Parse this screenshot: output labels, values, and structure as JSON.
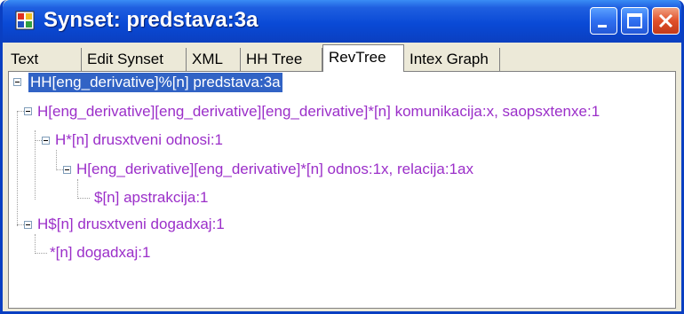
{
  "window": {
    "title": "Synset: predstava:3a",
    "icon": "app-window-icon",
    "controls": [
      "minimize-icon",
      "maximize-icon",
      "close-icon"
    ]
  },
  "tabs": [
    {
      "label": "Text"
    },
    {
      "label": "Edit Synset"
    },
    {
      "label": "XML"
    },
    {
      "label": "HH Tree"
    },
    {
      "label": "RevTree",
      "active": true
    },
    {
      "label": "Intex Graph"
    }
  ],
  "tree": {
    "nodes": [
      {
        "label": "HH[eng_derivative]%[n] predstava:3a",
        "selected": true
      },
      {
        "label": "H[eng_derivative][eng_derivative][eng_derivative]*[n] komunikacija:x, saopsxtenxe:1"
      },
      {
        "label": "H*[n] drusxtveni odnosi:1"
      },
      {
        "label": "H[eng_derivative][eng_derivative]*[n] odnos:1x, relacija:1ax"
      },
      {
        "label": "$[n] apstrakcija:1"
      },
      {
        "label": "H$[n] drusxtveni dogadxaj:1"
      },
      {
        "label": "*[n] dogadxaj:1"
      }
    ]
  },
  "colors": {
    "titlebar": "#0a4ad6",
    "node_text": "#9b2fc9",
    "selection": "#3163c5",
    "window_face": "#ece9d8"
  }
}
